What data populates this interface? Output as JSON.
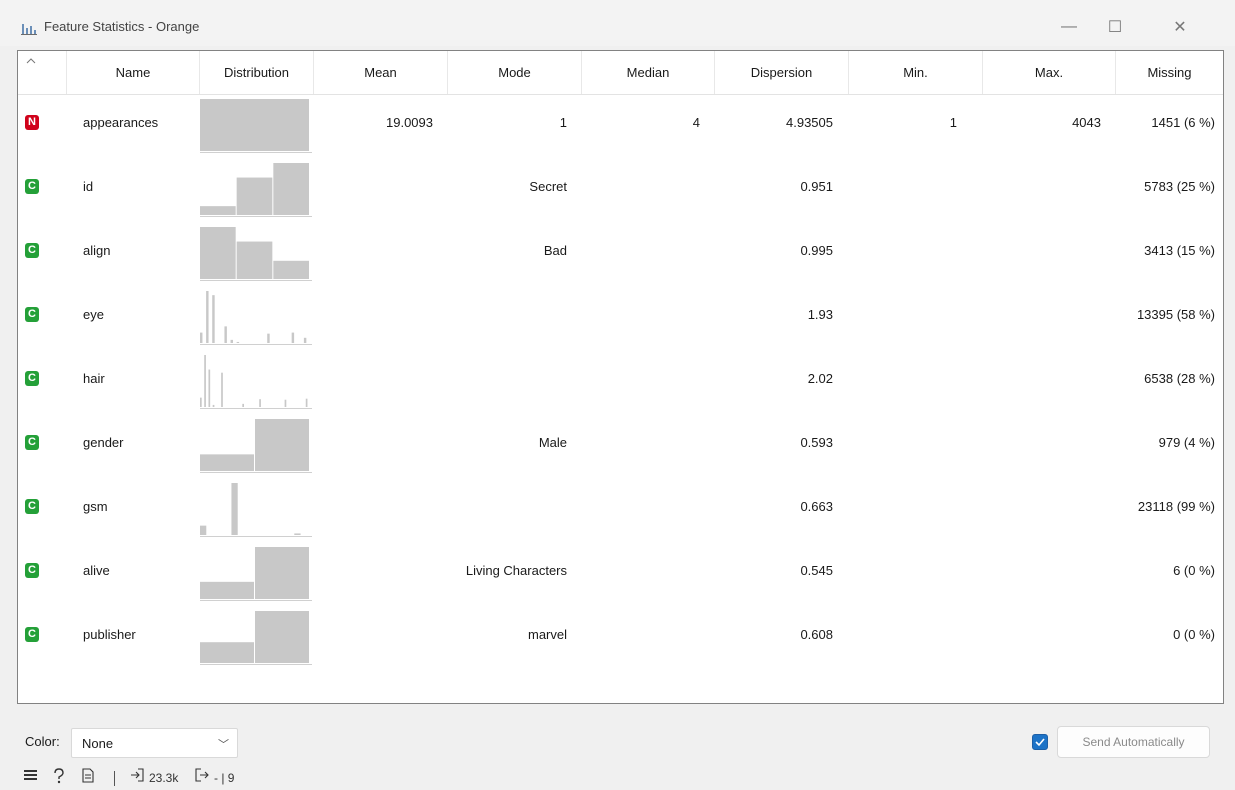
{
  "window": {
    "title": "Feature Statistics - Orange",
    "minimize_glyph": "—",
    "maximize_glyph": "☐",
    "close_glyph": "✕"
  },
  "columns": [
    "Name",
    "Distribution",
    "Mean",
    "Mode",
    "Median",
    "Dispersion",
    "Min.",
    "Max.",
    "Missing"
  ],
  "rows": [
    {
      "type": "N",
      "name": "appearances",
      "mean": "19.0093",
      "mode": "1",
      "median": "4",
      "dispersion": "4.93505",
      "min": "1",
      "max": "4043",
      "missing": "1451 (6 %)",
      "hist": [
        100
      ]
    },
    {
      "type": "C",
      "name": "id",
      "mean": "",
      "mode": "Secret",
      "median": "",
      "dispersion": "0.951",
      "min": "",
      "max": "",
      "missing": "5783 (25 %)",
      "hist": [
        17,
        72,
        100
      ]
    },
    {
      "type": "C",
      "name": "align",
      "mean": "",
      "mode": "Bad",
      "median": "",
      "dispersion": "0.995",
      "min": "",
      "max": "",
      "missing": "3413 (15 %)",
      "hist": [
        100,
        72,
        35
      ]
    },
    {
      "type": "C",
      "name": "eye",
      "mean": "",
      "mode": "",
      "median": "",
      "dispersion": "1.93",
      "min": "",
      "max": "",
      "missing": "13395 (58 %)",
      "hist": [
        20,
        100,
        92,
        0,
        32,
        6,
        2,
        0,
        0,
        0,
        0,
        18,
        0,
        0,
        0,
        20,
        0,
        10
      ]
    },
    {
      "type": "C",
      "name": "hair",
      "mean": "",
      "mode": "",
      "median": "",
      "dispersion": "2.02",
      "min": "",
      "max": "",
      "missing": "6538 (28 %)",
      "hist": [
        18,
        100,
        72,
        4,
        0,
        66,
        0,
        0,
        0,
        0,
        6,
        0,
        0,
        0,
        15,
        0,
        0,
        0,
        0,
        0,
        14,
        0,
        0,
        0,
        0,
        16
      ]
    },
    {
      "type": "C",
      "name": "gender",
      "mean": "",
      "mode": "Male",
      "median": "",
      "dispersion": "0.593",
      "min": "",
      "max": "",
      "missing": "979 (4 %)",
      "hist": [
        32,
        100
      ]
    },
    {
      "type": "C",
      "name": "gsm",
      "mean": "",
      "mode": "",
      "median": "",
      "dispersion": "0.663",
      "min": "",
      "max": "",
      "missing": "23118 (99 %)",
      "hist": [
        18,
        0,
        100,
        0,
        0,
        0,
        3
      ]
    },
    {
      "type": "C",
      "name": "alive",
      "mean": "",
      "mode": "Living Characters",
      "median": "",
      "dispersion": "0.545",
      "min": "",
      "max": "",
      "missing": "6 (0 %)",
      "hist": [
        33,
        100
      ]
    },
    {
      "type": "C",
      "name": "publisher",
      "mean": "",
      "mode": "marvel",
      "median": "",
      "dispersion": "0.608",
      "min": "",
      "max": "",
      "missing": "0 (0 %)",
      "hist": [
        40,
        100
      ]
    }
  ],
  "controls": {
    "color_label": "Color:",
    "color_value": "None",
    "send_auto_checked": true,
    "send_auto_label": "Send Automatically"
  },
  "status": {
    "input_summary": "23.3k",
    "output_summary": "- | 9"
  },
  "colors": {
    "numeric_badge": "#d0021b",
    "categorical_badge": "#24a038",
    "histogram_bar": "#c8c8c8",
    "checkbox": "#1d73c7"
  }
}
